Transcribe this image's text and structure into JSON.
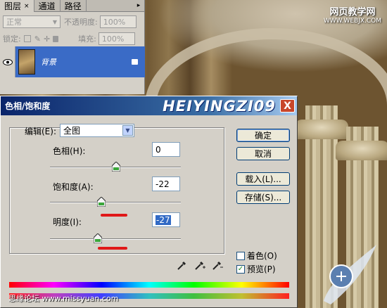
{
  "layers_panel": {
    "tabs": [
      {
        "label": "图层",
        "close": "×"
      },
      {
        "label": "通道"
      },
      {
        "label": "路径"
      }
    ],
    "panel_menu_icon": "▸",
    "blend_mode": "正常",
    "opacity_label": "不透明度:",
    "opacity_value": "100%",
    "lock_label": "锁定:",
    "fill_label": "填充:",
    "fill_value": "100%",
    "layer_name": "背景"
  },
  "watermark_top": {
    "line1": "网页教学网",
    "line2": "WWW.WEBJX.COM"
  },
  "dialog": {
    "title": "色相/饱和度",
    "brand": "HEIYINGZI09",
    "close_label": "X",
    "edit_label": "编辑(E):",
    "edit_value": "全图",
    "hue_label": "色相(H):",
    "hue_value": "0",
    "saturation_label": "饱和度(A):",
    "saturation_value": "-22",
    "lightness_label": "明度(I):",
    "lightness_value": "-27",
    "buttons": {
      "ok": "确定",
      "cancel": "取消",
      "load": "载入(L)...",
      "save": "存储(S)..."
    },
    "colorize_label": "着色(O)",
    "colorize_checked": false,
    "preview_label": "预览(P)",
    "preview_checked": true
  },
  "watermark_bottom": "思缘论坛  www.missyuan.com",
  "colors": {
    "titlebar_start": "#0a246a",
    "selection_blue": "#3a6bc6",
    "annotation_red": "#e01818"
  }
}
